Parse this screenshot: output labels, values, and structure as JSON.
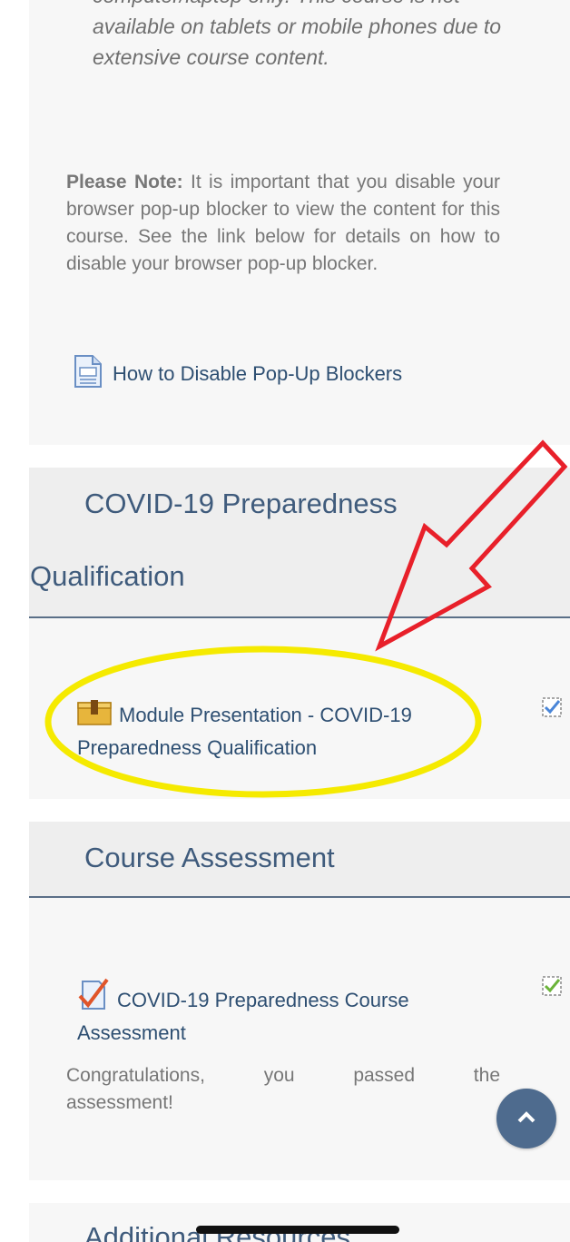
{
  "intro": {
    "italic_line_cut": "computer/laptop only. This course is not",
    "italic_line_2": "available on tablets or mobile phones due to",
    "italic_line_3": "extensive course content.",
    "note_label": "Please Note:",
    "note_body": " It is important that you disable your browser pop-up blocker to view the content for this course. See the link below for details on how to disable your browser pop-up blocker.",
    "link_label": "How to Disable Pop-Up Blockers",
    "link_icon": "document-icon"
  },
  "sections": {
    "covid": {
      "title_line_1": "COVID-19 Preparedness",
      "title_line_2": "Qualification",
      "activity_label": "Module Presentation - COVID-19 Preparedness Qualification",
      "activity_icon": "package-icon",
      "completion_icon": "checkbox-checked-icon"
    },
    "assessment": {
      "title": "Course Assessment",
      "activity_label": "COVID-19 Preparedness Course Assessment",
      "activity_icon": "quiz-icon",
      "completion_icon": "checkbox-checked-icon",
      "message_line_1": "Congratulations, you passed the",
      "message_line_2": "assessment!"
    },
    "resources": {
      "title": "Additional Resources"
    }
  },
  "colors": {
    "heading": "#3f5b7c",
    "link": "#2e4f72",
    "annotation_arrow": "#e8202a",
    "annotation_ellipse": "#f5ea00",
    "scroll_button": "#4e6b8e"
  },
  "scroll_top_icon": "chevron-up-icon"
}
